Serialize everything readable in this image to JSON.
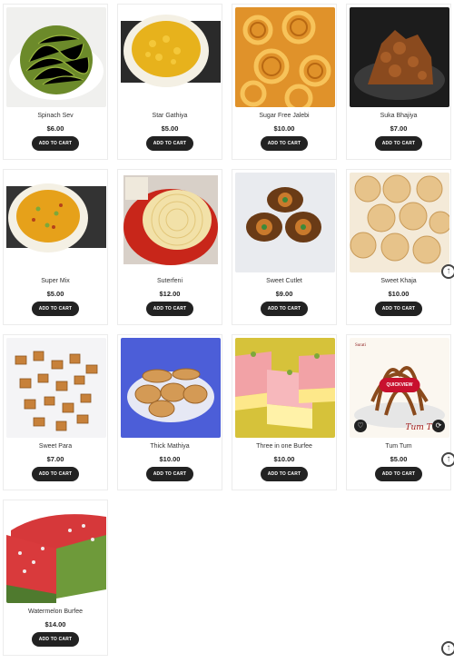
{
  "products": [
    {
      "name": "Spinach Sev",
      "price": "$6.00",
      "cta": "ADD TO CART",
      "image": "spinach-sev-photo"
    },
    {
      "name": "Star Gathiya",
      "price": "$5.00",
      "cta": "ADD TO CART",
      "image": "star-gathiya-photo"
    },
    {
      "name": "Sugar Free Jalebi",
      "price": "$10.00",
      "cta": "ADD TO CART",
      "image": "jalebi-photo"
    },
    {
      "name": "Suka Bhajiya",
      "price": "$7.00",
      "cta": "ADD TO CART",
      "image": "suka-bhajiya-photo"
    },
    {
      "name": "Super Mix",
      "price": "$5.00",
      "cta": "ADD TO CART",
      "image": "super-mix-photo"
    },
    {
      "name": "Suterfeni",
      "price": "$12.00",
      "cta": "ADD TO CART",
      "image": "suterfeni-photo"
    },
    {
      "name": "Sweet Cutlet",
      "price": "$9.00",
      "cta": "ADD TO CART",
      "image": "sweet-cutlet-photo"
    },
    {
      "name": "Sweet Khaja",
      "price": "$10.00",
      "cta": "ADD TO CART",
      "image": "sweet-khaja-photo"
    },
    {
      "name": "Sweet Para",
      "price": "$7.00",
      "cta": "ADD TO CART",
      "image": "sweet-para-photo"
    },
    {
      "name": "Thick Mathiya",
      "price": "$10.00",
      "cta": "ADD TO CART",
      "image": "thick-mathiya-photo"
    },
    {
      "name": "Three in one Burfee",
      "price": "$10.00",
      "cta": "ADD TO CART",
      "image": "three-in-one-burfee-photo"
    },
    {
      "name": "Tum Tum",
      "price": "$5.00",
      "cta": "ADD TO CART",
      "image": "tum-tum-photo",
      "quickview": "QUICKVIEW",
      "brand": "Surati",
      "script": "Tum Tum"
    },
    {
      "name": "Watermelon Burfee",
      "price": "$14.00",
      "cta": "ADD TO CART",
      "image": "watermelon-burfee-photo"
    }
  ],
  "icons": {
    "wishlist": "heart-icon",
    "compare": "refresh-icon",
    "scroll_top": "arrow-up-icon"
  },
  "colors": {
    "button": "#222222",
    "quickview": "#c8102e"
  }
}
